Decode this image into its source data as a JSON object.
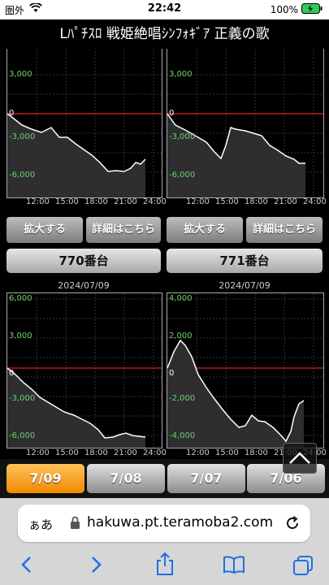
{
  "status": {
    "carrier": "圏外",
    "time": "22:42",
    "battery": "100%"
  },
  "title": "Lﾊﾟﾁｽﾛ 戦姫絶唱ｼﾝﾌｫｷﾞｱ 正義の歌",
  "top_charts": {
    "left": {
      "y_ticks": [
        "3,000",
        "0",
        "-3,000",
        "-6,000"
      ],
      "x_ticks": [
        "12:00",
        "15:00",
        "18:00",
        "21:00",
        "24:00"
      ]
    },
    "right": {
      "y_ticks": [
        "3,000",
        "0",
        "-3,000",
        "-6,000"
      ],
      "x_ticks": [
        "12:00",
        "15:00",
        "18:00",
        "21:00",
        "24:00"
      ]
    }
  },
  "buttons": {
    "zoom": "拡大する",
    "details": "詳細はこちら"
  },
  "machines": [
    {
      "label": "770番台",
      "date": "2024/07/09",
      "y_ticks": [
        "6,000",
        "3,000",
        "0",
        "-3,000",
        "-6,000"
      ],
      "x_ticks": [
        "12:00",
        "15:00",
        "18:00",
        "21:00",
        "24:00"
      ]
    },
    {
      "label": "771番台",
      "date": "2024/07/09",
      "y_ticks": [
        "4,000",
        "2,000",
        "0",
        "-2,000",
        "-4,000"
      ],
      "x_ticks": [
        "12:00",
        "15:00",
        "18:00",
        "21:00",
        "24:00"
      ]
    }
  ],
  "date_tabs": [
    "7/09",
    "7/08",
    "7/07",
    "7/06"
  ],
  "browser": {
    "aa": "ぁあ",
    "url": "hakuwa.pt.teramoba2.com"
  }
}
